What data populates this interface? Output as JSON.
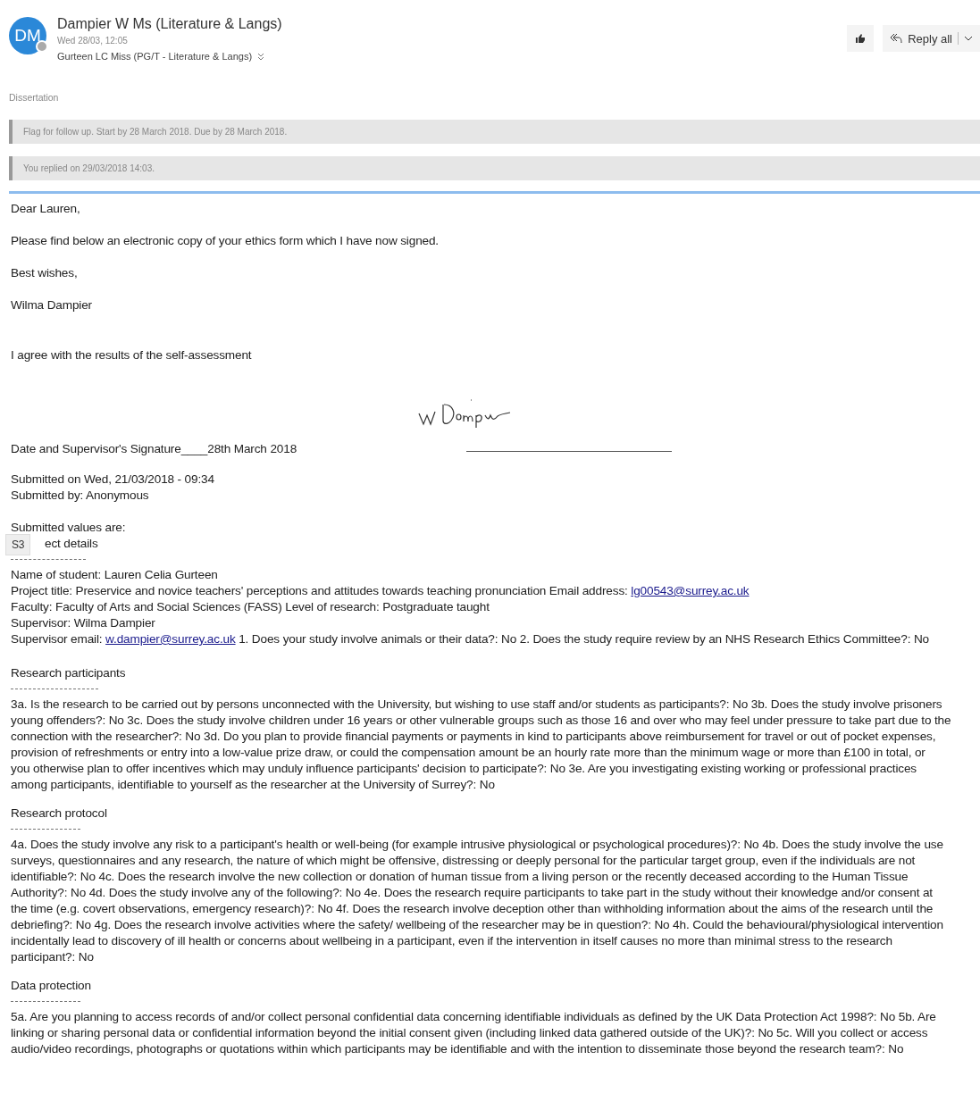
{
  "sender": {
    "initials": "DM",
    "name": "Dampier W Ms (Literature & Langs)",
    "date": "Wed 28/03, 12:05",
    "recipients": "Gurteen LC Miss (PG/T - Literature & Langs)",
    "available": false
  },
  "actions": {
    "reply_all": "Reply all"
  },
  "subject": "Dissertation",
  "info_bars": [
    "Flag for follow up. Start by 28 March 2018. Due by 28 March 2018.",
    "You replied on 29/03/2018 14:03."
  ],
  "body": {
    "greeting": "Dear Lauren,",
    "message": "Please find below an electronic copy of your ethics form which I have now signed.",
    "closing": "Best wishes,",
    "signoff": "Wilma Dampier",
    "agreement": "I agree with the results of the self-assessment",
    "signature_line": "Date and Supervisor's Signature____28th March 2018",
    "submitted": [
      "Submitted on Wed, 21/03/2018 - 09:34",
      "Submitted by: Anonymous"
    ],
    "values_heading": "Submitted values are:",
    "overlay_badge": "S3",
    "first_section": "ect details",
    "details": [
      {
        "text": "Name of student: Lauren Celia Gurteen"
      },
      {
        "text": "Project title: Preservice and novice teachers' perceptions and attitudes towards teaching pronunciation Email address: ",
        "link": "lg00543@surrey.ac.uk"
      },
      {
        "text": "Faculty: Faculty of Arts and Social Sciences (FASS) Level of research: Postgraduate taught"
      },
      {
        "text": "Supervisor: Wilma Dampier"
      },
      {
        "text": "Supervisor email: ",
        "link": "w.dampier@surrey.ac.uk",
        "after": " 1. Does your study involve animals or their data?: No 2. Does the study require review by an NHS Research Ethics Committee?: No"
      }
    ],
    "sections": [
      {
        "heading": "Research participants",
        "lines": [
          "3a. Is the research to be carried out by persons unconnected with the University, but wishing to use staff and/or students as participants?: No 3b. Does the study involve prisoners",
          "young offenders?: No 3c. Does the study involve children under 16 years or other vulnerable groups such as those 16 and over who may feel under pressure to take part due to the",
          "connection with the researcher?: No 3d. Do you plan to provide financial payments or payments in kind to participants above reimbursement for travel or out of pocket expenses,",
          "provision of refreshments or entry into a low-value prize draw, or could the compensation amount be an hourly rate more than the minimum wage or more than £100 in total, or",
          "you otherwise plan to offer incentives which may unduly influence participants' decision to participate?: No 3e. Are you investigating existing working or professional practices",
          "among participants, identifiable to yourself as the researcher at the University of Surrey?: No"
        ]
      },
      {
        "heading": "Research protocol",
        "lines": [
          "4a. Does the study involve any risk to a participant's health or well-being (for example intrusive physiological or psychological procedures)?: No 4b. Does the study involve the use",
          "surveys, questionnaires and any research, the nature of which might be offensive, distressing or deeply personal for the particular target group, even if the individuals are not",
          "identifiable?: No 4c. Does the research involve the new collection or donation of human tissue from a living person or the recently deceased according to the Human Tissue",
          "Authority?: No 4d. Does the study involve any of the following?: No 4e. Does the research require participants to take part in the study without their knowledge and/or consent at",
          "the time (e.g. covert observations, emergency research)?: No 4f. Does the research involve deception other than withholding information about the aims of the research until the",
          "debriefing?: No 4g. Does the research involve activities where the safety/ wellbeing of the researcher may be in question?: No 4h. Could the behavioural/physiological intervention",
          "incidentally lead to discovery of ill health or concerns about wellbeing in a participant, even if the intervention in itself causes no more than minimal stress to the research",
          "participant?: No"
        ]
      },
      {
        "heading": "Data protection",
        "lines": [
          "5a. Are you planning to access records of and/or collect personal confidential data concerning identifiable individuals as defined by the UK Data Protection Act 1998?: No 5b. Are",
          "linking or sharing personal data or confidential information beyond the initial consent given (including linked data gathered outside of the UK)?: No 5c. Will you collect or access",
          "audio/video recordings, photographs or quotations within which participants may be identifiable and with the intention to disseminate those beyond the research team?: No"
        ]
      }
    ]
  }
}
